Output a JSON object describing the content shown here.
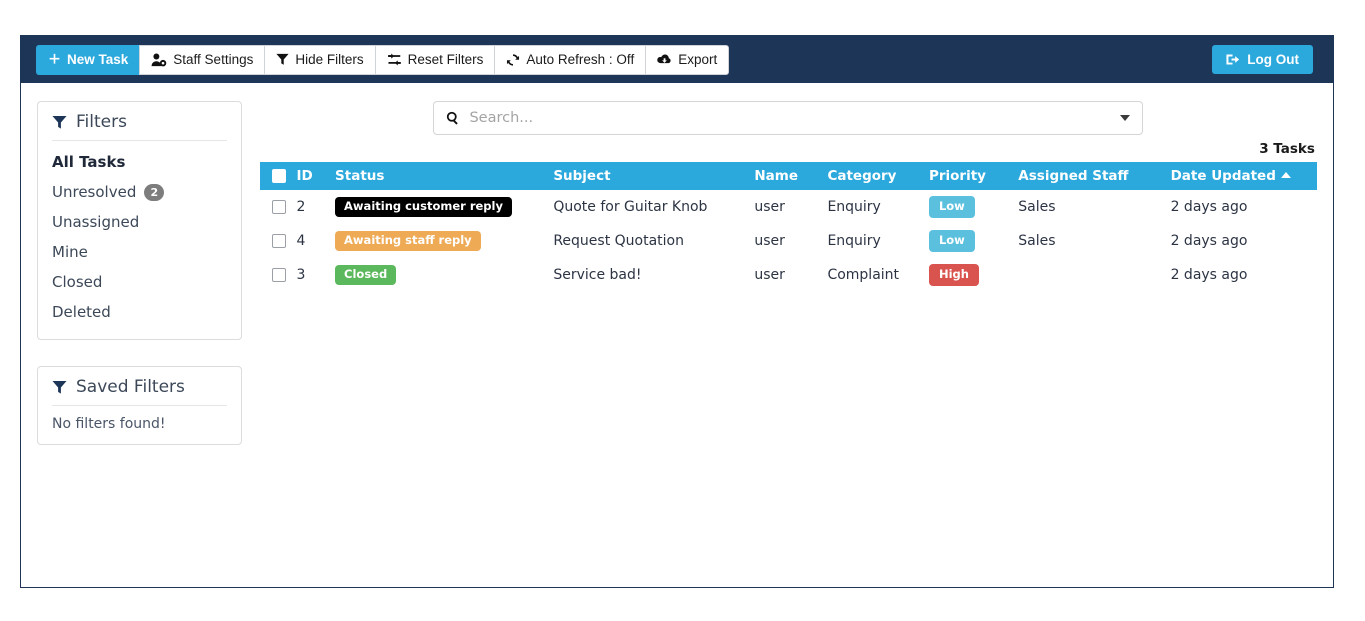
{
  "toolbar": {
    "buttons": [
      {
        "label": "New Task",
        "icon": "plus-icon",
        "style": "primary"
      },
      {
        "label": "Staff Settings",
        "icon": "user-gear-icon",
        "style": "default"
      },
      {
        "label": "Hide Filters",
        "icon": "funnel-icon",
        "style": "default"
      },
      {
        "label": "Reset Filters",
        "icon": "exchange-icon",
        "style": "default"
      },
      {
        "label": "Auto Refresh : Off",
        "icon": "refresh-icon",
        "style": "default"
      },
      {
        "label": "Export",
        "icon": "cloud-download-icon",
        "style": "default"
      }
    ],
    "logout_label": "Log Out",
    "logout_icon": "sign-out-icon",
    "bar_color": "#1d3557",
    "accent_color": "#2bA8DC"
  },
  "sidebar": {
    "filters_panel": {
      "title": "Filters",
      "icon": "funnel-icon",
      "items": [
        {
          "label": "All Tasks",
          "active": true,
          "count": ""
        },
        {
          "label": "Unresolved",
          "active": false,
          "count": "2"
        },
        {
          "label": "Unassigned",
          "active": false,
          "count": ""
        },
        {
          "label": "Mine",
          "active": false,
          "count": ""
        },
        {
          "label": "Closed",
          "active": false,
          "count": ""
        },
        {
          "label": "Deleted",
          "active": false,
          "count": ""
        }
      ]
    },
    "saved_filters_panel": {
      "title": "Saved Filters",
      "icon": "funnel-icon",
      "empty_text": "No filters found!"
    }
  },
  "search": {
    "icon": "search-icon",
    "placeholder": "Search...",
    "value": "",
    "dropdown_icon": "caret-down-icon"
  },
  "table": {
    "task_count_label": "3 Tasks",
    "sorted_column": "Date Updated",
    "sort_direction": "asc",
    "columns": [
      {
        "key": "select",
        "label": ""
      },
      {
        "key": "id",
        "label": "ID"
      },
      {
        "key": "status",
        "label": "Status"
      },
      {
        "key": "subject",
        "label": "Subject"
      },
      {
        "key": "name",
        "label": "Name"
      },
      {
        "key": "category",
        "label": "Category"
      },
      {
        "key": "priority",
        "label": "Priority"
      },
      {
        "key": "staff",
        "label": "Assigned Staff"
      },
      {
        "key": "date",
        "label": "Date Updated"
      }
    ],
    "rows": [
      {
        "id": "2",
        "status": "Awaiting customer reply",
        "status_color": "#000000",
        "subject": "Quote for Guitar Knob",
        "name": "user",
        "category": "Enquiry",
        "priority": "Low",
        "priority_color": "#5bc0de",
        "staff": "Sales",
        "date": "2 days ago",
        "checked": false
      },
      {
        "id": "4",
        "status": "Awaiting staff reply",
        "status_color": "#eeaa55",
        "subject": "Request Quotation",
        "name": "user",
        "category": "Enquiry",
        "priority": "Low",
        "priority_color": "#5bc0de",
        "staff": "Sales",
        "date": "2 days ago",
        "checked": false
      },
      {
        "id": "3",
        "status": "Closed",
        "status_color": "#5cb85c",
        "subject": "Service bad!",
        "name": "user",
        "category": "Complaint",
        "priority": "High",
        "priority_color": "#d9534f",
        "staff": "",
        "date": "2 days ago",
        "checked": false
      }
    ]
  }
}
